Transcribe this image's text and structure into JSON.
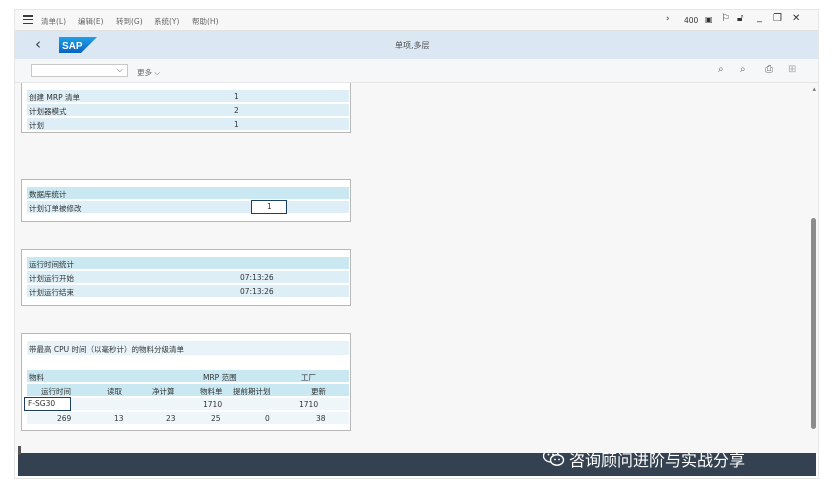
{
  "menubar": {
    "items": [
      "清单(L)",
      "编辑(E)",
      "转到(G)",
      "系统(Y)",
      "帮助(H)"
    ],
    "client": "400"
  },
  "header": {
    "title": "单项,多层"
  },
  "toolbar": {
    "more_label": "更多"
  },
  "panel1": {
    "rows": [
      {
        "label": "创建 MRP 清单",
        "value": "1"
      },
      {
        "label": "计划器模式",
        "value": "2"
      },
      {
        "label": "计划",
        "value": "1"
      }
    ]
  },
  "panel2": {
    "header": "数据库统计",
    "row_label": "计划订单被修改",
    "row_value": "1"
  },
  "panel3": {
    "header": "运行时间统计",
    "rows": [
      {
        "label": "计划运行开始",
        "value": "07:13:26"
      },
      {
        "label": "计划运行结束",
        "value": "07:13:26"
      }
    ]
  },
  "panel4": {
    "title": "带最高 CPU 时间（以毫秒计）的物料分级清单",
    "header1": {
      "material": "物料",
      "mrp_scope": "MRP 范围",
      "plant": "工厂"
    },
    "header2": {
      "runtime": "运行时间",
      "read": "读取",
      "net_calc": "净计算",
      "bom": "物料单",
      "lead_plan": "提前期计划",
      "update": "更新"
    },
    "row1": {
      "material": "F-SG30",
      "mrp_scope": "1710",
      "plant": "1710"
    },
    "row2": {
      "runtime": "269",
      "read": "13",
      "net_calc": "23",
      "bom": "25",
      "lead_plan": "0",
      "update": "38"
    }
  },
  "watermark": {
    "text": "咨询顾问进阶与实战分享"
  },
  "colors": {
    "header_bg": "#dbe7f2",
    "row_bg": "#ddeef7",
    "row_header_bg": "#c9e8f2",
    "footer_bg": "#334150"
  }
}
